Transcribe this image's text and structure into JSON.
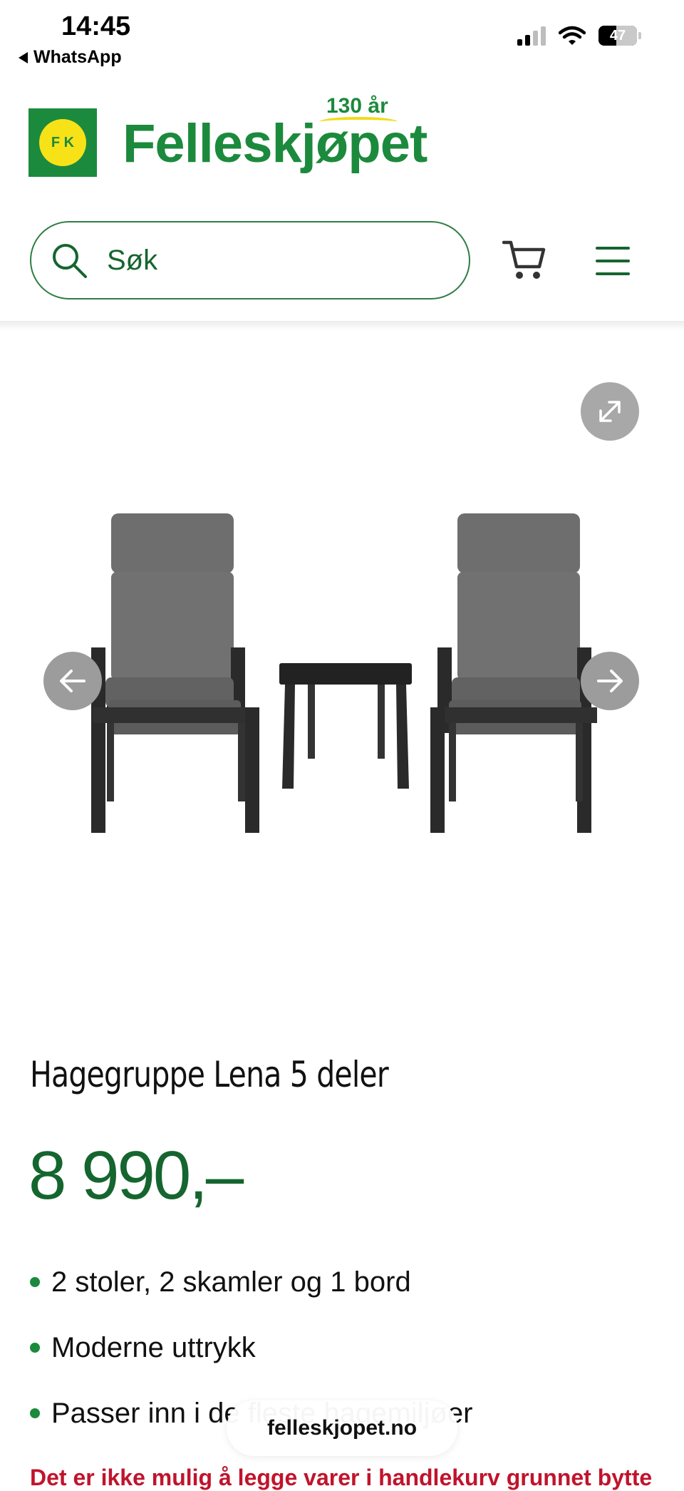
{
  "status_bar": {
    "time": "14:45",
    "back_app": "WhatsApp",
    "battery": "47",
    "battery_level": 0.47
  },
  "header": {
    "logo_mark_text": "F K",
    "brand_name": "Felleskjøpet",
    "anniversary": "130 år",
    "search_placeholder": "Søk",
    "icons": {
      "search": "search-icon",
      "cart": "cart-icon",
      "menu": "hamburger-menu-icon"
    }
  },
  "gallery": {
    "icons": {
      "expand": "expand-icon",
      "prev": "arrow-left-icon",
      "next": "arrow-right-icon"
    }
  },
  "product": {
    "title": "Hagegruppe Lena 5 deler",
    "price": "8 990,–",
    "features": [
      "2 stoler, 2 skamler og 1 bord",
      "Moderne uttrykk",
      "Passer inn i de fleste hagemiljøer"
    ],
    "notice": "Det er ikke mulig å legge varer i handlekurv grunnet bytte"
  },
  "browser": {
    "url": "felleskjopet.no"
  },
  "colors": {
    "brand_green": "#1c8a3c",
    "brand_yellow": "#f7e218",
    "price_green": "#15652f",
    "notice_red": "#c0142c"
  }
}
